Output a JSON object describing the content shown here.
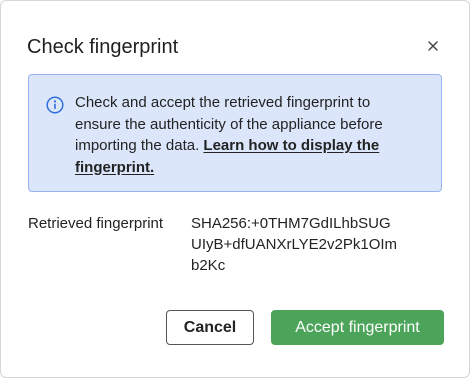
{
  "dialog": {
    "title": "Check fingerprint",
    "close_icon": "close-icon"
  },
  "info": {
    "icon": "info-icon",
    "text": "Check and accept the retrieved fingerprint to ensure the authenticity of the appliance before importing the data. ",
    "link_text": "Learn how to display the fingerprint.",
    "accent_color": "#2f6fdb",
    "background_color": "#dbe6fb"
  },
  "fingerprint": {
    "label": "Retrieved fingerprint",
    "value_lines": [
      "SHA256:+0THM7GdILhbSUG",
      "UIyB+dfUANXrLYE2v2Pk1OIm",
      "b2Kc"
    ]
  },
  "buttons": {
    "cancel_label": "Cancel",
    "accept_label": "Accept fingerprint",
    "accept_color": "#4ba459"
  }
}
